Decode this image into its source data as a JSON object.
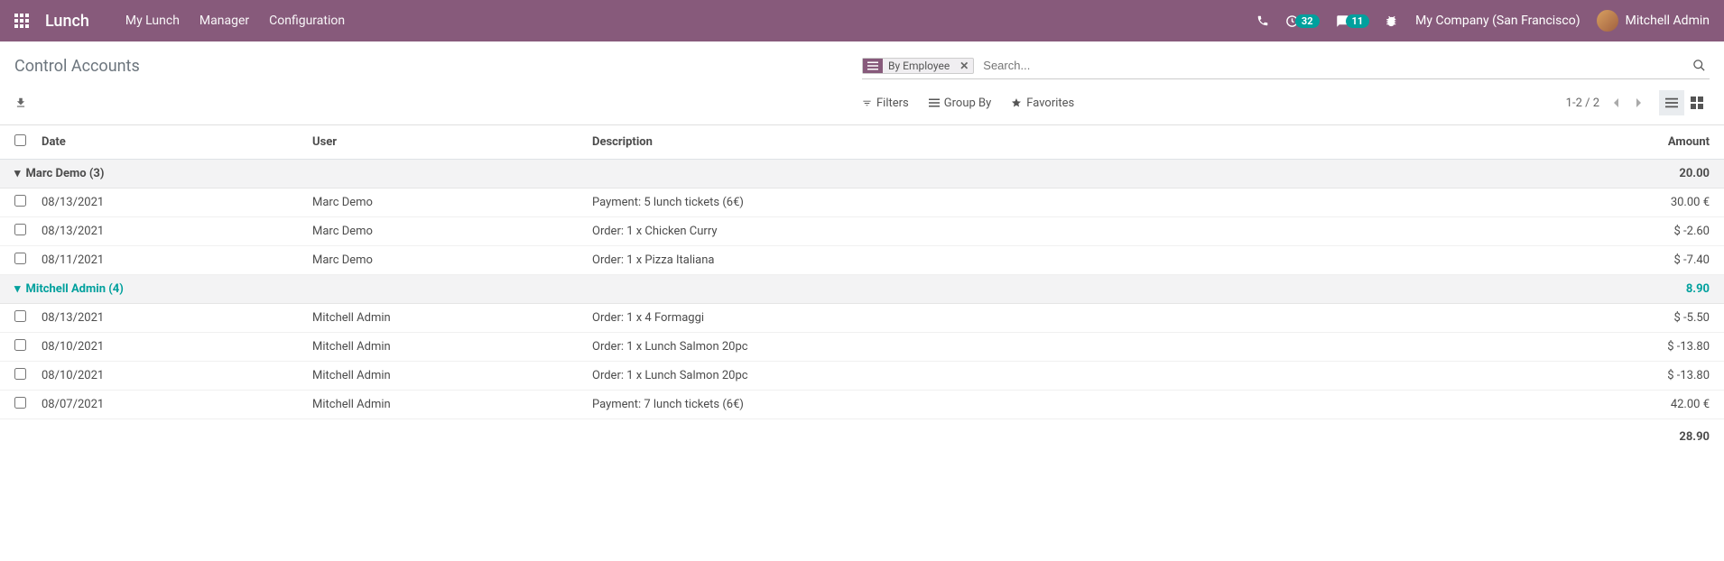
{
  "navbar": {
    "brand": "Lunch",
    "menu": [
      "My Lunch",
      "Manager",
      "Configuration"
    ],
    "activities_badge": "32",
    "discuss_badge": "11",
    "company": "My Company (San Francisco)",
    "user": "Mitchell Admin"
  },
  "cp": {
    "title": "Control Accounts",
    "facet_label": "By Employee",
    "search_placeholder": "Search...",
    "filters": "Filters",
    "groupby": "Group By",
    "favorites": "Favorites",
    "pager": "1-2 / 2"
  },
  "table": {
    "headers": {
      "date": "Date",
      "user": "User",
      "description": "Description",
      "amount": "Amount"
    },
    "groups": [
      {
        "label": "Marc Demo (3)",
        "total": "20.00",
        "active": false,
        "rows": [
          {
            "date": "08/13/2021",
            "user": "Marc Demo",
            "description": "Payment: 5 lunch tickets (6€)",
            "amount": "30.00 €"
          },
          {
            "date": "08/13/2021",
            "user": "Marc Demo",
            "description": "Order: 1 x Chicken Curry",
            "amount": "$ -2.60"
          },
          {
            "date": "08/11/2021",
            "user": "Marc Demo",
            "description": "Order: 1 x Pizza Italiana",
            "amount": "$ -7.40"
          }
        ]
      },
      {
        "label": "Mitchell Admin (4)",
        "total": "8.90",
        "active": true,
        "rows": [
          {
            "date": "08/13/2021",
            "user": "Mitchell Admin",
            "description": "Order: 1 x 4 Formaggi",
            "amount": "$ -5.50"
          },
          {
            "date": "08/10/2021",
            "user": "Mitchell Admin",
            "description": "Order: 1 x Lunch Salmon 20pc",
            "amount": "$ -13.80"
          },
          {
            "date": "08/10/2021",
            "user": "Mitchell Admin",
            "description": "Order: 1 x Lunch Salmon 20pc",
            "amount": "$ -13.80"
          },
          {
            "date": "08/07/2021",
            "user": "Mitchell Admin",
            "description": "Payment: 7 lunch tickets (6€)",
            "amount": "42.00 €"
          }
        ]
      }
    ],
    "grand_total": "28.90"
  }
}
